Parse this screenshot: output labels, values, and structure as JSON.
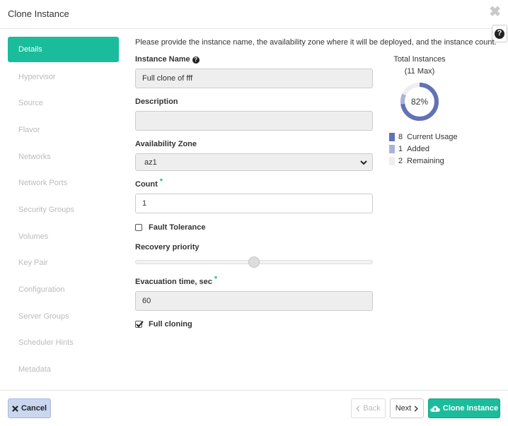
{
  "header": {
    "title": "Clone Instance",
    "close_glyph": "✖",
    "help_glyph": "?"
  },
  "nav": {
    "items": [
      {
        "label": "Details",
        "active": true
      },
      {
        "label": "Hypervisor"
      },
      {
        "label": "Source"
      },
      {
        "label": "Flavor"
      },
      {
        "label": "Networks"
      },
      {
        "label": "Network Ports"
      },
      {
        "label": "Security Groups"
      },
      {
        "label": "Volumes"
      },
      {
        "label": "Key Pair"
      },
      {
        "label": "Configuration"
      },
      {
        "label": "Server Groups"
      },
      {
        "label": "Scheduler Hints"
      },
      {
        "label": "Metadata"
      }
    ]
  },
  "form": {
    "intro": "Please provide the instance name, the availability zone where it will be deployed, and the instance count.",
    "instance_name_label": "Instance Name",
    "instance_name_value": "Full clone of fff",
    "description_label": "Description",
    "description_value": "",
    "az_label": "Availability Zone",
    "az_value": "az1",
    "count_label": "Count",
    "count_value": "1",
    "required_mark": "*",
    "fault_tolerance_label": "Fault Tolerance",
    "fault_tolerance_checked": false,
    "recovery_priority_label": "Recovery priority",
    "recovery_priority_level": 0.5,
    "evacuation_label": "Evacuation time, sec",
    "evacuation_value": "60",
    "full_cloning_label": "Full cloning",
    "full_cloning_checked": true
  },
  "quota": {
    "title": "Total Instances",
    "subtitle": "(11 Max)",
    "percent_label": "82%",
    "legend": [
      {
        "count": "8",
        "label": "Current Usage",
        "color": "#6272b5"
      },
      {
        "count": "1",
        "label": "Added",
        "color": "#aab3d9"
      },
      {
        "count": "2",
        "label": "Remaining",
        "color": "#eeeeee"
      }
    ]
  },
  "footer": {
    "cancel_label": "Cancel",
    "back_label": "Back",
    "next_label": "Next",
    "clone_label": "Clone Instance"
  },
  "colors": {
    "accent": "#1abc9c",
    "cancel_bg": "#c9d6f0"
  }
}
